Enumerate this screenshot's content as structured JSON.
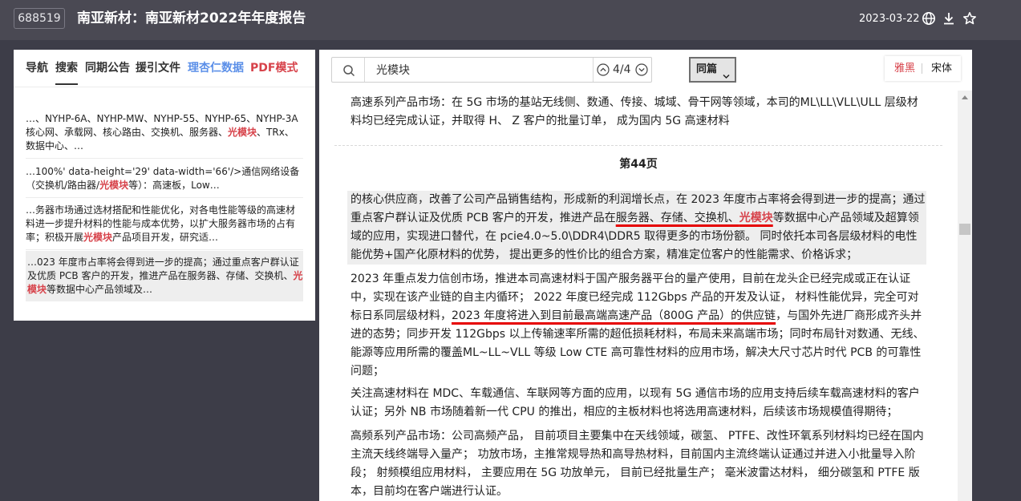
{
  "header": {
    "stock_code": "688519",
    "title": "南亚新材：南亚新材2022年年度报告",
    "date": "2023-03-22",
    "icons": [
      "globe-icon",
      "download-icon",
      "star-icon"
    ]
  },
  "sidebar": {
    "tabs": [
      {
        "label": "导航",
        "style": "normal"
      },
      {
        "label": "搜索",
        "style": "active"
      },
      {
        "label": "同期公告",
        "style": "normal"
      },
      {
        "label": "援引文件",
        "style": "normal"
      },
      {
        "label": "理杏仁数据",
        "style": "blue"
      },
      {
        "label": "PDF模式",
        "style": "red"
      }
    ],
    "results": [
      {
        "before": "…、NYHP-6A、NYHP-MW、NYHP-55、NYHP-65、NYHP-3A核心网、承载网、核心路由、交换机、服务器、",
        "match": "光模块",
        "after": "、TRx、数据中心、…"
      },
      {
        "before": "…100%' data-height='29' data-width='66'/>通信网络设备（交换机/路由器/",
        "match": "光模块",
        "after": "等）：高速板，Low…"
      },
      {
        "before": "…务器市场通过选材搭配和性能优化，对各电性能等级的高速材料进一步提升材料的性能与成本优势，以扩大服务器市场的占有率；积极开展",
        "match": "光模块",
        "after": "产品项目开发，研究适…"
      },
      {
        "before": "…023 年度市占率将会得到进一步的提高；通过重点客户群认证及优质 PCB 客户的开发，推进产品在服务器、存储、交换机、",
        "match": "光模块",
        "after": "等数据中心产品领域及…"
      }
    ]
  },
  "search": {
    "query": "光模块",
    "counter": "4/4",
    "scope": "同篇"
  },
  "font_toggle": {
    "yahei": "雅黑",
    "song": "宋体"
  },
  "document": {
    "para_top": "高速系列产品市场：在 5G 市场的基站无线侧、数通、传接、城域、骨干网等领域，本司的ML\\LL\\VLL\\ULL 层级材料均已经完成认证，并取得 H、 Z 客户的批量订单， 成为国内 5G 高速材料",
    "page_label": "第44页",
    "para_hl": {
      "a": "的核心供应商，改善了公司产品销售结构，形成新的利润增长点，在 2023 年度市占率将会得到进一步的提高；通过重点客户群认证及优质 PCB 客户的开发，推进产品在",
      "u1": "服务器、存储、交换机、",
      "match": "光模块",
      "b": "等数据中心产品领域及超算领域的应用，实现进口替代，在 pcie4.0~5.0\\DDR4\\DDR5 取得更多的市场份额。 同时依托本司各层级材料的电性能优势+国产化原材料的优势， 提出更多的性价比的组合方案，精准定位客户的性能需求、价格诉求；"
    },
    "para_2023": {
      "a": "2023 年重点发力信创市场，推进本司高速材料于国产服务器平台的量产使用，目前在龙头企已经完成或正在认证中，实现在该产业链的自主内循环； 2022 年度已经完成 112Gbps 产品的开发及认证， 材料性能优异，完全可对标日系同层级材料，",
      "u": "2023 年度将进入到目前最高端高速产品（800G 产品）的供应链",
      "b": "，与国外先进厂商形成齐头并进的态势；同步开发 112Gbps 以上传输速率所需的超低损耗材料，布局未来高端市场；同时布局针对数通、无线、能源等应用所需的覆盖ML~LL~VLL 等级 Low CTE 高可靠性材料的应用市场，解决大尺寸芯片时代 PCB 的可靠性问题；"
    },
    "para_auto": "关注高速材料在 MDC、车载通信、车联网等方面的应用，以现有 5G 通信市场的应用支持后续车载高速材料的客户认证；另外 NB 市场随着新一代 CPU 的推出，相应的主板材料也将选用高速材料，后续该市场规模值得期待；",
    "para_hf": "高频系列产品市场：公司高频产品， 目前项目主要集中在天线领域，碳氢、 PTFE、改性环氧系列材料均已经在国内主流天线终端导入量产； 功放市场，主推常规导热和高导热材料，目前国内主流终端认证通过并进入小批量导入阶段； 射频模组应用材料， 主要应用在 5G 功放单元， 目前已经批量生产； 毫米波雷达材料， 细分碳氢和 PTFE 版本，目前均在客户端进行认证。"
  }
}
